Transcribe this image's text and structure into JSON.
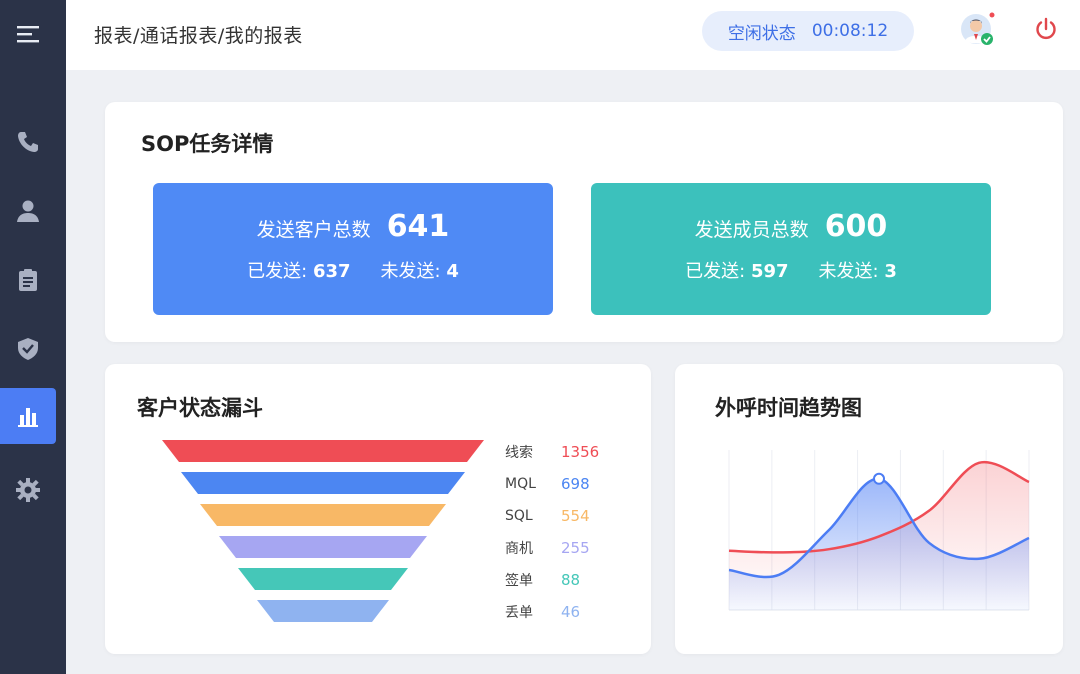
{
  "header": {
    "breadcrumb": "报表/通话报表/我的报表",
    "status_label": "空闲状态",
    "status_time": "00:08:12"
  },
  "sidebar": {
    "items": [
      {
        "icon": "menu-icon"
      },
      {
        "icon": "phone-icon"
      },
      {
        "icon": "user-icon"
      },
      {
        "icon": "clipboard-icon"
      },
      {
        "icon": "shield-icon"
      },
      {
        "icon": "bar-chart-icon",
        "active": true
      },
      {
        "icon": "gear-icon"
      }
    ]
  },
  "sop": {
    "title": "SOP任务详情",
    "customers": {
      "label": "发送客户总数",
      "total": "641",
      "sent_label": "已发送:",
      "sent": "637",
      "unsent_label": "未发送:",
      "unsent": "4",
      "color": "#4f8af5"
    },
    "members": {
      "label": "发送成员总数",
      "total": "600",
      "sent_label": "已发送:",
      "sent": "597",
      "unsent_label": "未发送:",
      "unsent": "3",
      "color": "#3cc1bc"
    }
  },
  "funnel": {
    "title": "客户状态漏斗",
    "stages": [
      {
        "name": "线索",
        "value": "1356",
        "color": "#ef4d55"
      },
      {
        "name": "MQL",
        "value": "698",
        "color": "#4c86f2"
      },
      {
        "name": "SQL",
        "value": "554",
        "color": "#f8b866"
      },
      {
        "name": "商机",
        "value": "255",
        "color": "#a6a6f2"
      },
      {
        "name": "签单",
        "value": "88",
        "color": "#45c7b8"
      },
      {
        "name": "丢单",
        "value": "46",
        "color": "#8fb3f0"
      }
    ]
  },
  "trend": {
    "title": "外呼时间趋势图",
    "series": [
      {
        "color": "#ef4d55",
        "values": [
          0.37,
          0.36,
          0.38,
          0.46,
          0.62,
          0.92,
          0.8
        ]
      },
      {
        "color": "#4c7df4",
        "values": [
          0.25,
          0.22,
          0.5,
          0.82,
          0.42,
          0.32,
          0.45
        ]
      }
    ]
  }
}
